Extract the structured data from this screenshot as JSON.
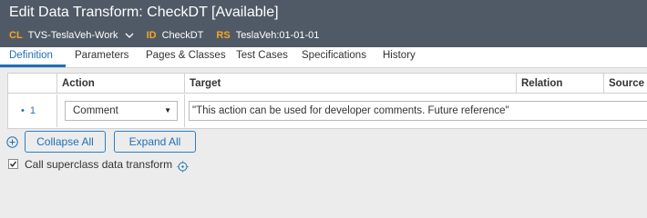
{
  "header": {
    "title": "Edit Data Transform: CheckDT [Available]",
    "meta": [
      {
        "key": "CL",
        "value": "TVS-TeslaVeh-Work"
      },
      {
        "key": "ID",
        "value": "CheckDT"
      },
      {
        "key": "RS",
        "value": "TeslaVeh:01-01-01"
      }
    ]
  },
  "tabs": [
    {
      "label": "Definition",
      "active": true
    },
    {
      "label": "Parameters"
    },
    {
      "label": "Pages & Classes"
    },
    {
      "label": "Test Cases"
    },
    {
      "label": "Specifications"
    },
    {
      "label": "History"
    }
  ],
  "table": {
    "columns": [
      "Action",
      "Target",
      "Relation",
      "Source"
    ],
    "rows": [
      {
        "number": "1",
        "action": "Comment",
        "target": "\"This  action can be used for developer comments. Future reference\""
      }
    ]
  },
  "buttons": {
    "collapse_all": "Collapse All",
    "expand_all": "Expand All"
  },
  "options": {
    "call_superclass_label": "Call superclass data transform",
    "call_superclass_checked": true
  },
  "colors": {
    "header_bg": "#505a66",
    "accent": "#1f6fb5",
    "meta_key": "#f5a623"
  }
}
